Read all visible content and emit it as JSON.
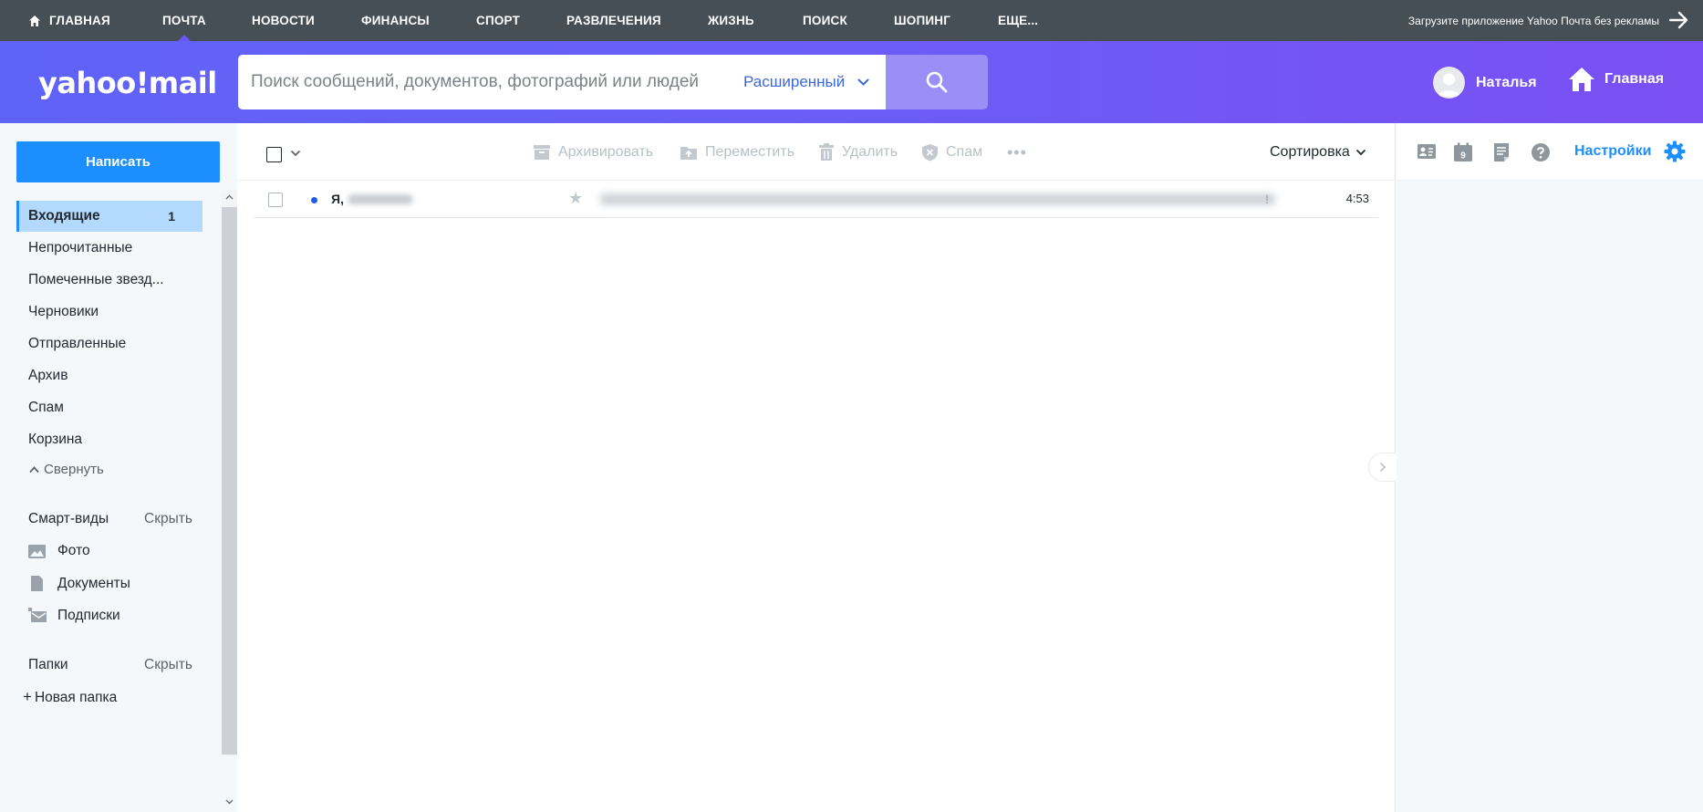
{
  "topnav": {
    "items": [
      {
        "label": "ГЛАВНАЯ"
      },
      {
        "label": "ПОЧТА"
      },
      {
        "label": "НОВОСТИ"
      },
      {
        "label": "ФИНАНСЫ"
      },
      {
        "label": "СПОРТ"
      },
      {
        "label": "РАЗВЛЕЧЕНИЯ"
      },
      {
        "label": "ЖИЗНЬ"
      },
      {
        "label": "ПОИСК"
      },
      {
        "label": "ШОПИНГ"
      },
      {
        "label": "ЕЩЕ..."
      }
    ],
    "active_item": "ПОЧТА",
    "promo_text": "Загрузите приложение Yahoo Почта без рекламы"
  },
  "header": {
    "logo_text": "yahoo!mail",
    "search_placeholder": "Поиск сообщений, документов, фотографий или людей",
    "advanced_label": "Расширенный",
    "user_name": "Наталья",
    "home_label": "Главная"
  },
  "sidebar": {
    "compose_label": "Написать",
    "folders": [
      {
        "label": "Входящие",
        "count": "1",
        "active": true
      },
      {
        "label": "Непрочитанные"
      },
      {
        "label": "Помеченные звезд..."
      },
      {
        "label": "Черновики"
      },
      {
        "label": "Отправленные"
      },
      {
        "label": "Архив"
      },
      {
        "label": "Спам"
      },
      {
        "label": "Корзина"
      }
    ],
    "collapse_label": "Свернуть",
    "smart_views": {
      "title": "Смарт-виды",
      "hide_label": "Скрыть",
      "items": [
        {
          "label": "Фото",
          "icon": "photo-icon"
        },
        {
          "label": "Документы",
          "icon": "document-icon"
        },
        {
          "label": "Подписки",
          "icon": "subscriptions-icon"
        }
      ]
    },
    "folders_section": {
      "title": "Папки",
      "hide_label": "Скрыть",
      "new_folder_label": "Новая папка"
    }
  },
  "toolbar": {
    "archive_label": "Архивировать",
    "move_label": "Переместить",
    "delete_label": "Удалить",
    "spam_label": "Спам",
    "more_label": "•••",
    "sort_label": "Сортировка"
  },
  "messages": [
    {
      "sender": "Я,",
      "time": "4:53",
      "unread": true,
      "subject_tail": "!"
    }
  ],
  "right_rail": {
    "settings_label": "Настройки",
    "calendar_day": "9"
  },
  "colors": {
    "topnav_bg": "#464e56",
    "header_gradient_start": "#5f63f7",
    "header_gradient_end": "#7a4ff3",
    "compose_button": "#1c8efd",
    "active_folder": "#b3d9fd",
    "link_blue": "#1c8efd"
  }
}
